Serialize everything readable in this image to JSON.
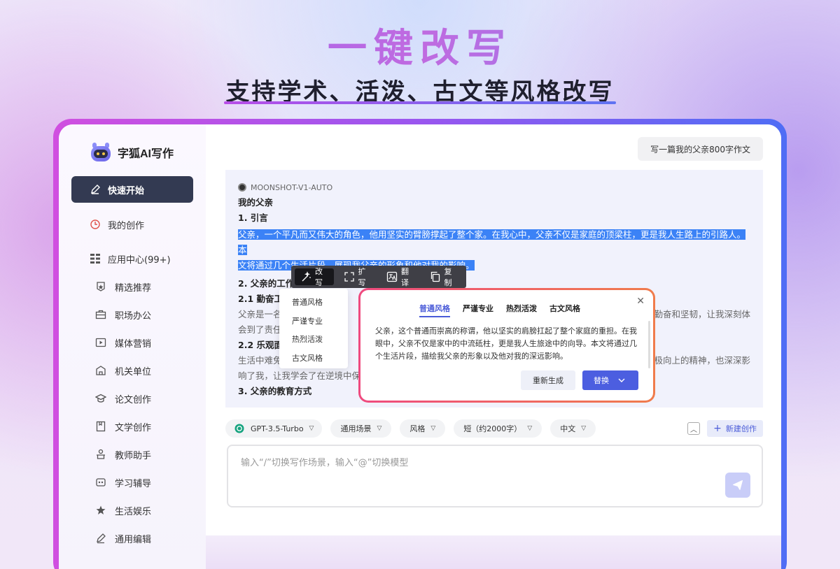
{
  "hero": {
    "title": "一键改写",
    "subtitle": "支持学术、活泼、古文等风格改写"
  },
  "sidebar": {
    "brand": "字狐AI写作",
    "primary": [
      {
        "label": "快速开始",
        "icon": "pen-icon"
      },
      {
        "label": "我的创作",
        "icon": "clock-icon"
      },
      {
        "label": "应用中心(99+)",
        "icon": "grid-icon"
      }
    ],
    "apps": [
      {
        "label": "精选推荐",
        "icon": "star-badge-icon"
      },
      {
        "label": "职场办公",
        "icon": "briefcase-icon"
      },
      {
        "label": "媒体营销",
        "icon": "media-icon"
      },
      {
        "label": "机关单位",
        "icon": "building-icon"
      },
      {
        "label": "论文创作",
        "icon": "graduation-cap-icon"
      },
      {
        "label": "文学创作",
        "icon": "book-icon"
      },
      {
        "label": "教师助手",
        "icon": "teacher-icon"
      },
      {
        "label": "学习辅导",
        "icon": "study-icon"
      },
      {
        "label": "生活娱乐",
        "icon": "star-icon"
      },
      {
        "label": "通用编辑",
        "icon": "edit-icon"
      }
    ]
  },
  "main": {
    "prompt_chip": "写一篇我的父亲800字作文",
    "model_name": "MOONSHOT-V1-AUTO",
    "doc": {
      "title": "我的父亲",
      "s1": "1. 引言",
      "p1_line1": "父亲，一个平凡而又伟大的角色，他用坚实的臂膀撑起了整个家。在我心中，父亲不仅是家庭的顶梁柱，更是我人生路上的引路人。本",
      "p1_line2": "文将通过几个生活片段，展现我父亲的形象和他对我的影响。",
      "s2": "2. 父亲的工作",
      "s21": "2.1 勤奋工作",
      "p2_line1_a": "父亲是一名",
      "p2_line1_b": "勤奋和坚韧，让我深刻体",
      "p2_line2": "会到了责任",
      "s22": "2.2 乐观面",
      "p3_line1_a": "生活中难免",
      "p3_line1_b": "极向上的精神，也深深影",
      "p3_line2": "响了我，让我学会了在逆境中保",
      "s3": "3. 父亲的教育方式"
    },
    "toolbar": [
      {
        "label": "改写",
        "icon": "magic-wand-icon"
      },
      {
        "label": "扩写",
        "icon": "expand-icon"
      },
      {
        "label": "翻译",
        "icon": "translate-icon"
      },
      {
        "label": "复制",
        "icon": "copy-icon"
      }
    ],
    "styles_menu": [
      "普通风格",
      "严谨专业",
      "热烈活泼",
      "古文风格"
    ],
    "rewrite": {
      "tabs": [
        "普通风格",
        "严谨专业",
        "热烈活泼",
        "古文风格"
      ],
      "text": "父亲，这个普通而崇高的称谓，他以坚实的肩膀扛起了整个家庭的重担。在我眼中，父亲不仅是家中的中流砥柱，更是我人生旅途中的向导。本文将通过几个生活片段，描绘我父亲的形象以及他对我的深远影响。",
      "regen": "重新生成",
      "replace": "替换"
    },
    "options": {
      "model": "GPT-3.5-Turbo",
      "scene": "通用场景",
      "style": "风格",
      "length": "短（约2000字）",
      "lang": "中文"
    },
    "new_creation": "新建创作",
    "input_placeholder": "输入“/”切换写作场景，输入“@”切换模型"
  }
}
